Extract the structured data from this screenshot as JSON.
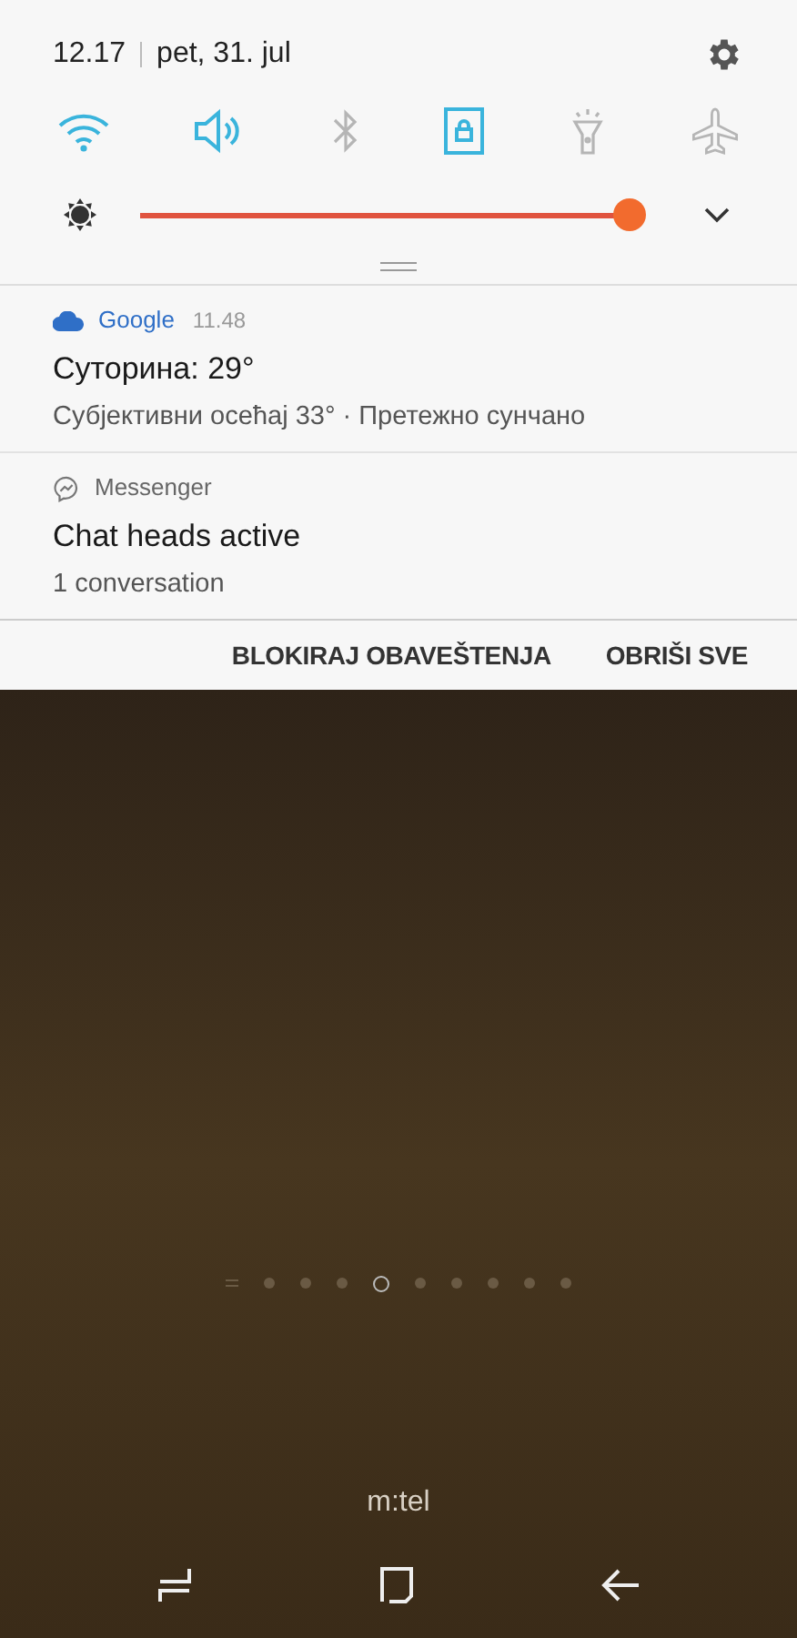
{
  "status": {
    "time": "12.17",
    "date": "pet, 31. jul"
  },
  "toggles": [
    {
      "kind": "wifi",
      "on": true
    },
    {
      "kind": "sound",
      "on": true
    },
    {
      "kind": "bluetooth",
      "on": false
    },
    {
      "kind": "rotation-lock",
      "on": true
    },
    {
      "kind": "flashlight",
      "on": false
    },
    {
      "kind": "airplane",
      "on": false
    }
  ],
  "brightness": {
    "level": 0.97
  },
  "notifications": [
    {
      "kind": "weather",
      "app": "Google",
      "time": "11.48",
      "title": "Суторина: 29°",
      "text": "Субјективни осећај 33° · Претежно сунчано"
    },
    {
      "kind": "messenger",
      "app": "Messenger",
      "title": "Chat heads active",
      "text": "1 conversation"
    }
  ],
  "actions": [
    "BLOKIRAJ OBAVEŠTENJA",
    "OBRIŠI SVE"
  ],
  "pages": [
    {
      "kind": "list",
      "selected": false
    },
    {
      "kind": "dot",
      "selected": false
    },
    {
      "kind": "dot",
      "selected": false
    },
    {
      "kind": "dot",
      "selected": false
    },
    {
      "kind": "dot",
      "selected": true
    },
    {
      "kind": "dot",
      "selected": false
    },
    {
      "kind": "dot",
      "selected": false
    },
    {
      "kind": "dot",
      "selected": false
    },
    {
      "kind": "dot",
      "selected": false
    },
    {
      "kind": "dot",
      "selected": false
    }
  ],
  "carrier": "m:tel"
}
